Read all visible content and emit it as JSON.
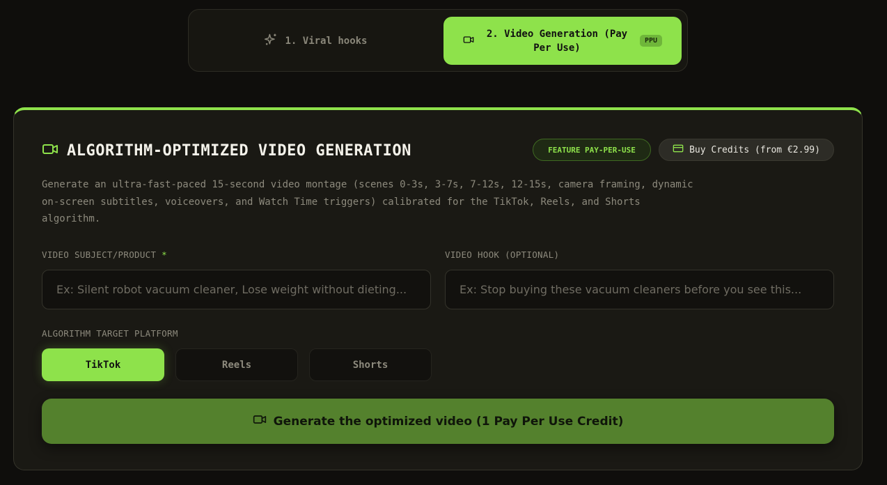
{
  "tabs": {
    "hooks_label": "1. Viral hooks",
    "video_label": "2. Video Generation (Pay Per Use)",
    "ppu_badge": "PPU"
  },
  "card": {
    "title": "ALGORITHM-OPTIMIZED VIDEO GENERATION",
    "feature_badge": "FEATURE PAY-PER-USE",
    "buy_credits": "Buy Credits (from €2.99)",
    "description": "Generate an ultra-fast-paced 15-second video montage (scenes 0-3s, 3-7s, 7-12s, 12-15s, camera framing, dynamic on-screen subtitles, voiceovers, and Watch Time triggers) calibrated for the TikTok, Reels, and Shorts algorithm.",
    "subject_label": "VIDEO SUBJECT/PRODUCT",
    "required_mark": "*",
    "subject_placeholder": "Ex: Silent robot vacuum cleaner, Lose weight without dieting...",
    "subject_value": "",
    "hook_label": "VIDEO HOOK (OPTIONAL)",
    "hook_placeholder": "Ex: Stop buying these vacuum cleaners before you see this...",
    "hook_value": "",
    "platform_label": "ALGORITHM TARGET PLATFORM",
    "platforms": [
      "TikTok",
      "Reels",
      "Shorts"
    ],
    "selected_platform": "TikTok",
    "generate_label": "Generate the optimized video (1 Pay Per Use Credit)"
  },
  "icons": {
    "hooks_tab": "sparkles-icon",
    "video_tab": "video-camera-icon",
    "title": "video-camera-icon",
    "buy": "credit-card-icon",
    "generate": "video-camera-icon"
  },
  "colors": {
    "accent": "#8ee24b",
    "generate_button": "#54812d",
    "background": "#0f0e0c",
    "card": "#1a1914"
  }
}
